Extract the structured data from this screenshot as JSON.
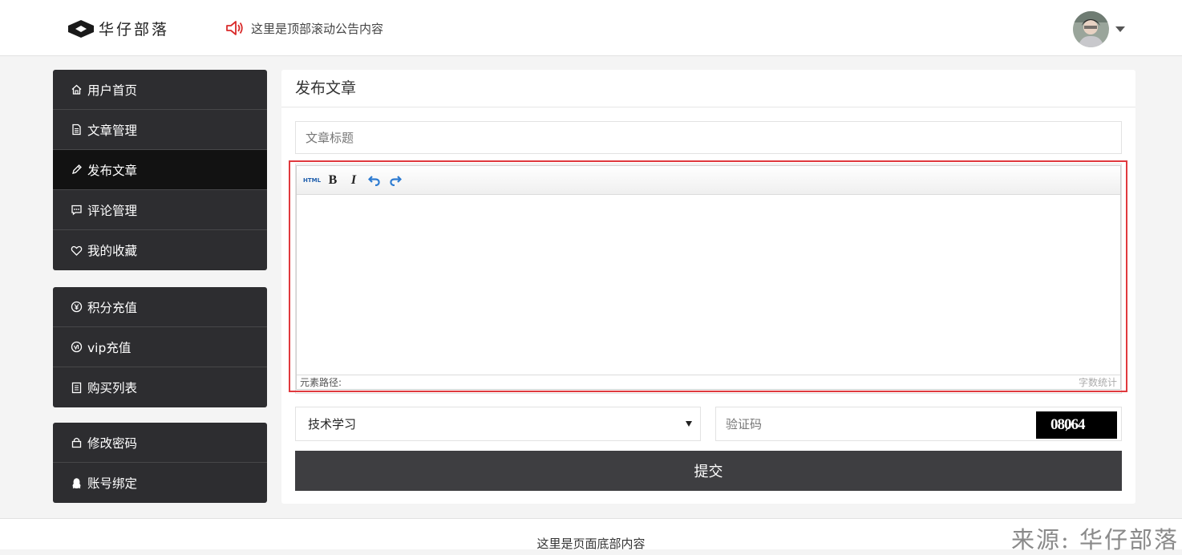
{
  "header": {
    "logo_text": "华仔部落",
    "notice": "这里是顶部滚动公告内容"
  },
  "sidebar": {
    "groups": [
      {
        "items": [
          {
            "label": "用户首页",
            "icon": "home-icon"
          },
          {
            "label": "文章管理",
            "icon": "document-icon"
          },
          {
            "label": "发布文章",
            "icon": "pencil-icon",
            "active": true
          },
          {
            "label": "评论管理",
            "icon": "comment-icon"
          },
          {
            "label": "我的收藏",
            "icon": "heart-icon"
          }
        ]
      },
      {
        "items": [
          {
            "label": "积分充值",
            "icon": "yen-coin-icon"
          },
          {
            "label": "vip充值",
            "icon": "vip-badge-icon"
          },
          {
            "label": "购买列表",
            "icon": "list-icon"
          }
        ]
      },
      {
        "items": [
          {
            "label": "修改密码",
            "icon": "lock-icon"
          },
          {
            "label": "账号绑定",
            "icon": "qq-penguin-icon"
          }
        ]
      }
    ]
  },
  "main": {
    "title": "发布文章",
    "title_placeholder": "文章标题",
    "editor": {
      "toolbar": [
        "HTML",
        "B",
        "I",
        "undo",
        "redo"
      ],
      "html_label": "HTML",
      "bold_label": "B",
      "italic_label": "I",
      "status_left": "元素路径:",
      "status_right": "字数统计"
    },
    "category_selected": "技术学习",
    "captcha_placeholder": "验证码",
    "captcha_text": "08064",
    "submit_label": "提交"
  },
  "footer": {
    "text": "这里是页面底部内容"
  },
  "watermark": "来源: 华仔部落",
  "colors": {
    "sidebar_bg": "#2d2d30",
    "sidebar_active_bg": "#121212",
    "accent_red": "#d10000",
    "highlight_border": "#e0393e",
    "submit_bg": "#3e3e41"
  }
}
